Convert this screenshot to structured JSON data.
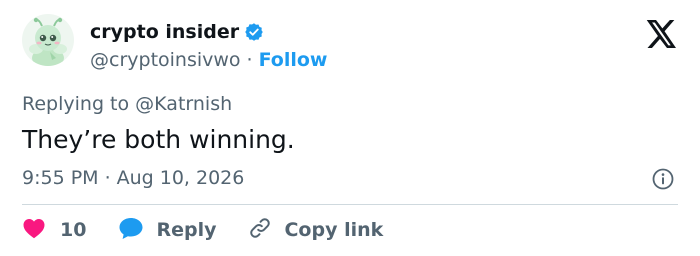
{
  "author": {
    "display_name": "crypto insider",
    "handle": "@cryptoinsivwo",
    "separator": "·",
    "follow_label": "Follow",
    "verified_color": "#1d9bf0"
  },
  "tweet": {
    "replying_prefix": "Replying to",
    "replying_to": "@Katrnish",
    "text": "They’re both winning.",
    "time": "9:55 PM",
    "separator": "·",
    "date": "Aug 10, 2026"
  },
  "actions": {
    "like_count": "10",
    "reply_label": "Reply",
    "copy_label": "Copy link",
    "like_color": "#f91880",
    "reply_color": "#1d9bf0"
  },
  "icons": [
    "x-logo-icon",
    "verified-badge-icon",
    "heart-icon",
    "speech-bubble-icon",
    "link-icon",
    "info-icon"
  ]
}
